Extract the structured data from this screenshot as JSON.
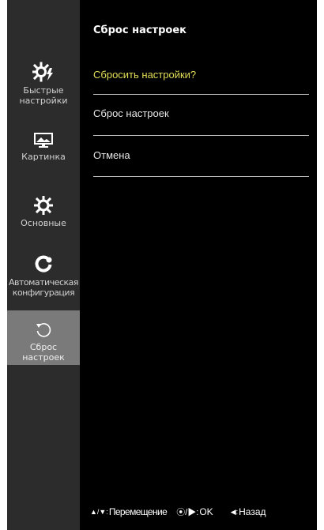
{
  "sidebar": {
    "items": [
      {
        "label": "Быстрые\nнастройки",
        "icon": "quick-settings-icon"
      },
      {
        "label": "Картинка",
        "icon": "picture-icon"
      },
      {
        "label": "Основные",
        "icon": "general-settings-icon"
      },
      {
        "label": "Автоматическая\nконфигурация",
        "icon": "auto-config-icon"
      },
      {
        "label": "Сброс\nнастроек",
        "icon": "reset-icon",
        "active": true
      }
    ]
  },
  "main": {
    "title": "Сброс настроек",
    "question": "Сбросить настройки?",
    "options": [
      "Сброс настроек",
      "Отмена"
    ]
  },
  "footer": {
    "move_symbols": "▲/▼:",
    "move_label": "Перемещение",
    "ok_symbols": "⦿/▶:",
    "ok_label": "OK",
    "back_symbols": "◀:",
    "back_label": "Назад"
  },
  "colors": {
    "background": "#000000",
    "sidebar": "#2c2c2c",
    "active_item": "#7a7a7a",
    "question_text": "#e1dd58"
  }
}
